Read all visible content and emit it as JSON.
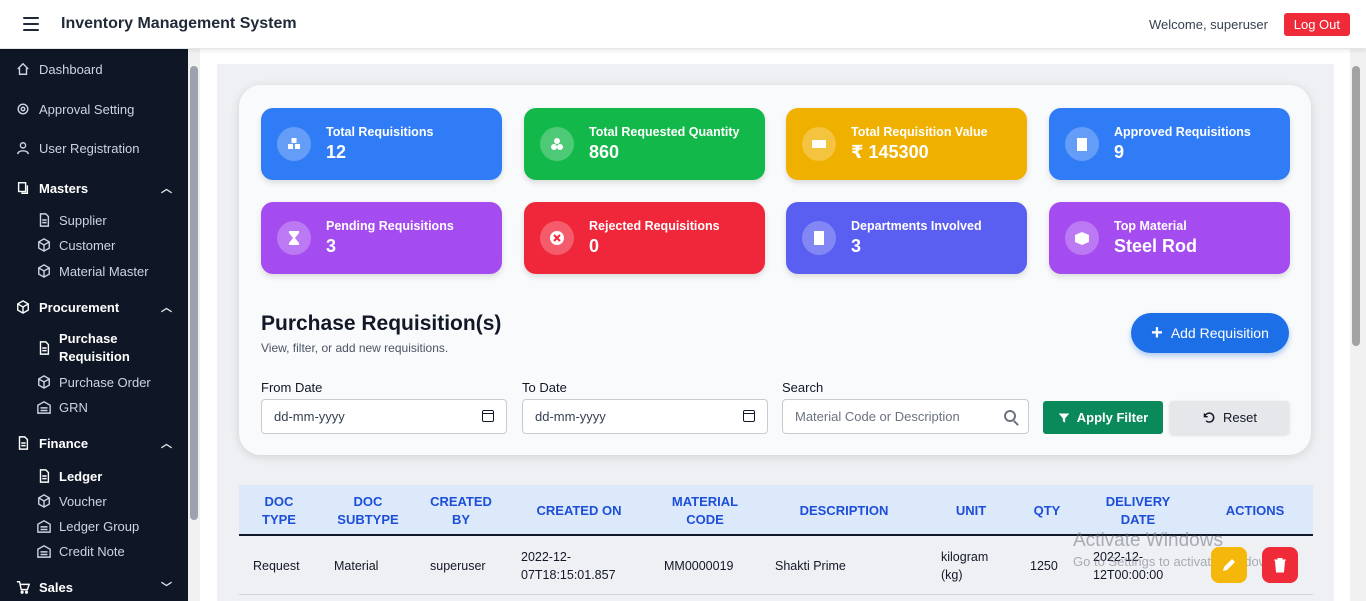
{
  "header": {
    "title": "Inventory Management System",
    "welcome": "Welcome, superuser",
    "logout_label": "Log Out"
  },
  "sidebar": {
    "dashboard": "Dashboard",
    "approval_setting": "Approval Setting",
    "user_registration": "User Registration",
    "masters": {
      "label": "Masters",
      "items": [
        "Supplier",
        "Customer",
        "Material Master"
      ]
    },
    "procurement": {
      "label": "Procurement",
      "items": [
        "Purchase Requisition",
        "Purchase Order",
        "GRN"
      ]
    },
    "finance": {
      "label": "Finance",
      "items": [
        "Ledger",
        "Voucher",
        "Ledger Group",
        "Credit Note"
      ]
    },
    "sales": {
      "label": "Sales"
    }
  },
  "stats": [
    {
      "label": "Total Requisitions",
      "value": "12",
      "color": "#2f7cf6",
      "icon": "boxes-icon"
    },
    {
      "label": "Total Requested Quantity",
      "value": "860",
      "color": "#13b84a",
      "icon": "cubes-icon"
    },
    {
      "label": "Total Requisition Value",
      "value": "₹ 145300",
      "color": "#f0b000",
      "icon": "money-icon"
    },
    {
      "label": "Approved Requisitions",
      "value": "9",
      "color": "#2f7cf6",
      "icon": "clipboard-check-icon"
    },
    {
      "label": "Pending Requisitions",
      "value": "3",
      "color": "#a44cf0",
      "icon": "hourglass-icon"
    },
    {
      "label": "Rejected Requisitions",
      "value": "0",
      "color": "#f0263a",
      "icon": "x-circle-icon"
    },
    {
      "label": "Departments Involved",
      "value": "3",
      "color": "#5a5ff2",
      "icon": "building-icon"
    },
    {
      "label": "Top Material",
      "value": "Steel Rod",
      "color": "#a44cf0",
      "icon": "box-open-icon"
    }
  ],
  "section": {
    "title": "Purchase Requisition(s)",
    "subtitle": "View, filter, or add new requisitions.",
    "add_label": "Add Requisition"
  },
  "filters": {
    "from_label": "From Date",
    "from_value": "dd-mm-yyyy",
    "to_label": "To Date",
    "to_value": "dd-mm-yyyy",
    "search_label": "Search",
    "search_placeholder": "Material Code or Description",
    "apply_label": "Apply Filter",
    "reset_label": "Reset"
  },
  "table": {
    "headers": [
      "DOC TYPE",
      "DOC SUBTYPE",
      "CREATED BY",
      "CREATED ON",
      "MATERIAL CODE",
      "DESCRIPTION",
      "UNIT",
      "QTY",
      "DELIVERY DATE",
      "ACTIONS"
    ],
    "rows": [
      [
        "Request",
        "Material",
        "superuser",
        "2022-12-07T18:15:01.857",
        "MM0000019",
        "Shakti Prime",
        "kilogram (kg)",
        "1250",
        "2022-12-12T00:00:00"
      ]
    ]
  },
  "watermark": {
    "line1": "Activate Windows",
    "line2": "Go to Settings to activate Windows."
  }
}
